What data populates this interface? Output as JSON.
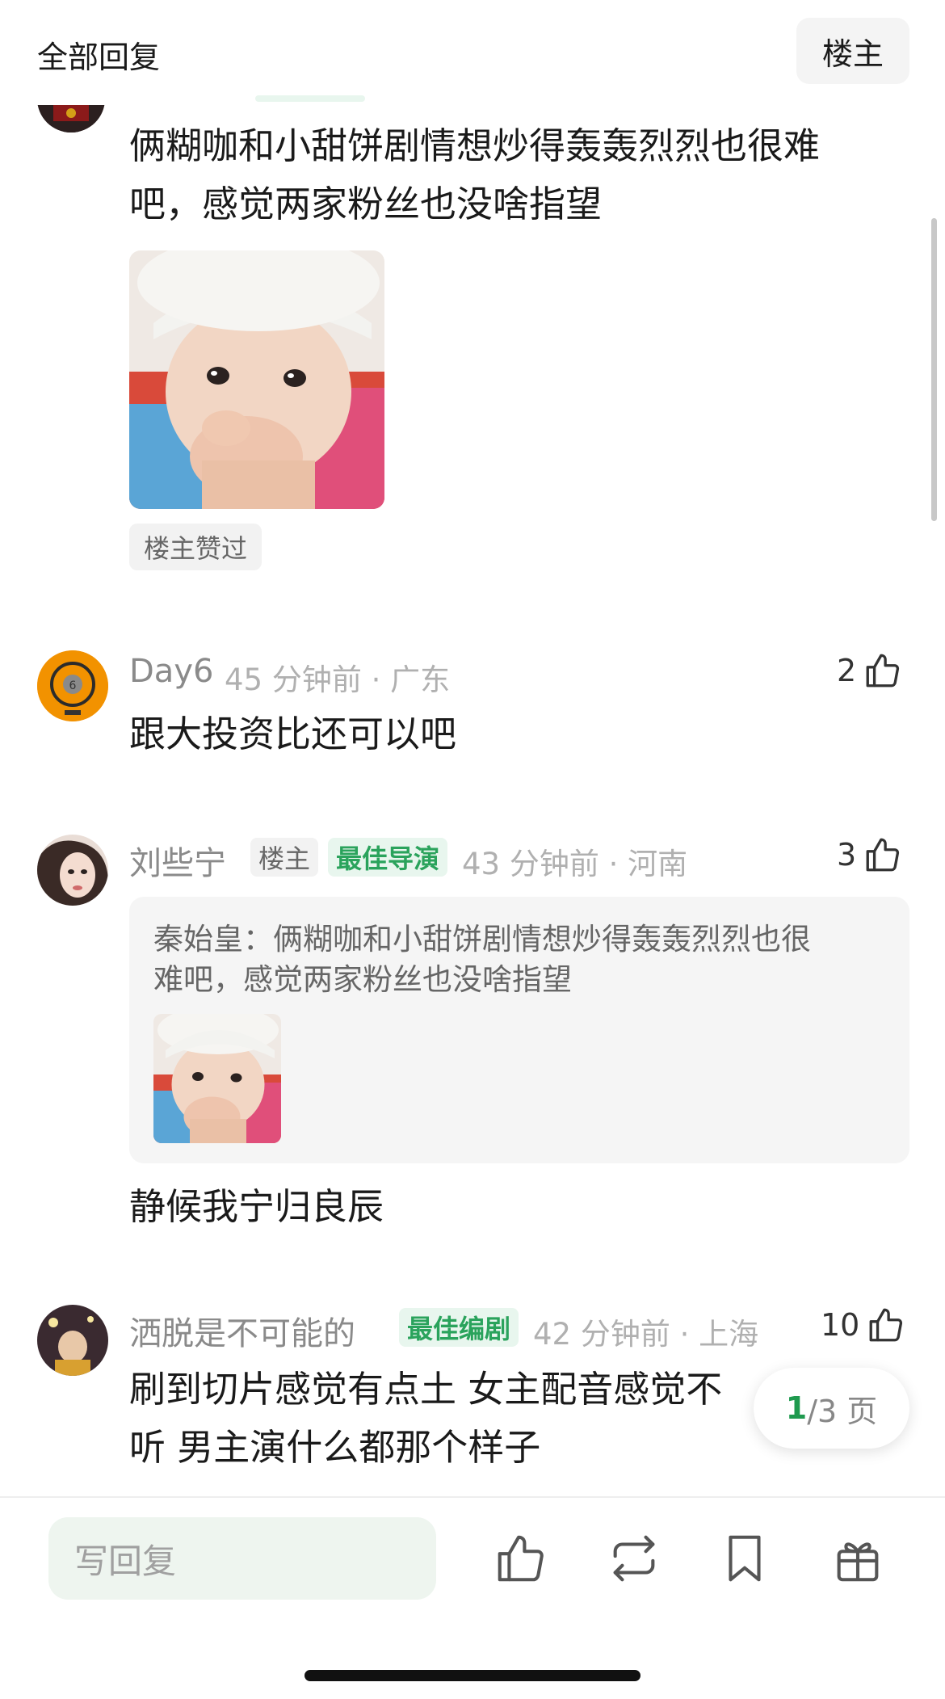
{
  "header": {
    "title": "全部回复",
    "owner_button": "楼主"
  },
  "top_comment": {
    "text_line1": "俩糊咖和小甜饼剧情想炒得轰轰烈烈也很难",
    "text_line2": "吧，感觉两家粉丝也没啥指望",
    "badge": "楼主赞过"
  },
  "comments": [
    {
      "user": "Day6",
      "time": "45 分钟前 · 广东",
      "likes": "2",
      "text": "跟大投资比还可以吧"
    },
    {
      "user": "刘些宁",
      "tag_owner": "楼主",
      "tag_title": "最佳导演",
      "time": "43 分钟前 · 河南",
      "likes": "3",
      "quote_line1": "秦始皇：俩糊咖和小甜饼剧情想炒得轰轰烈烈也很",
      "quote_line2": "难吧，感觉两家粉丝也没啥指望",
      "text": "静候我宁归良辰"
    },
    {
      "user": "洒脱是不可能的",
      "tag_title": "最佳编剧",
      "time": "42 分钟前 · 上海",
      "likes": "10",
      "text_line1": "刷到切片感觉有点土 女主配音感觉不",
      "text_line2": "听 男主演什么都那个样子"
    }
  ],
  "pagination": {
    "current": "1",
    "total": "/3 页"
  },
  "bottom_bar": {
    "reply_placeholder": "写回复",
    "icons": [
      "thumbs-up-icon",
      "repost-icon",
      "bookmark-icon",
      "gift-icon"
    ]
  },
  "colors": {
    "accent_green": "#2aa35c",
    "tag_green_bg": "#e8f6ee"
  }
}
